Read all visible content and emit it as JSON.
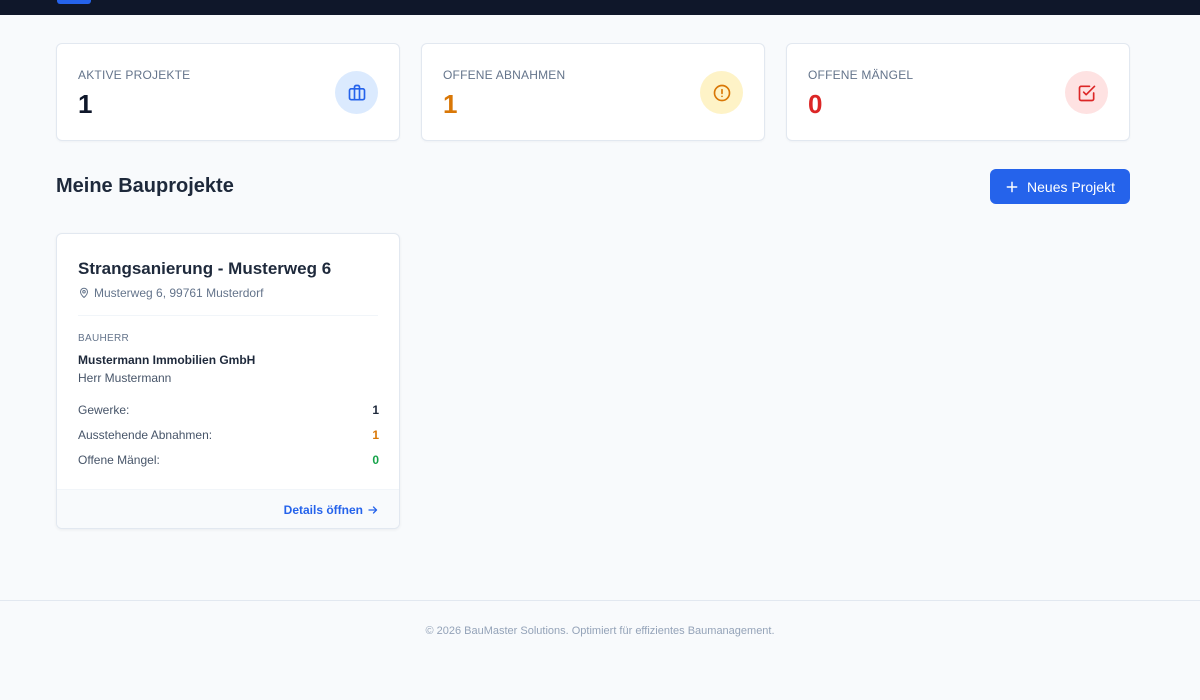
{
  "colors": {
    "primary": "#2563eb",
    "navbar": "#0f172a",
    "orange": "#d97706",
    "red": "#dc2626",
    "green": "#16a34a"
  },
  "stats": [
    {
      "label": "AKTIVE PROJEKTE",
      "value": "1",
      "icon": "briefcase-icon"
    },
    {
      "label": "OFFENE ABNAHMEN",
      "value": "1",
      "icon": "alert-circle-icon"
    },
    {
      "label": "OFFENE MÄNGEL",
      "value": "0",
      "icon": "check-square-icon"
    }
  ],
  "section": {
    "title": "Meine Bauprojekte",
    "new_project_label": "Neues Projekt"
  },
  "project": {
    "title": "Strangsanierung - Musterweg 6",
    "address": "Musterweg 6, 99761 Musterdorf",
    "client_label": "BAUHERR",
    "client_company": "Mustermann Immobilien GmbH",
    "client_contact": "Herr Mustermann",
    "metrics": [
      {
        "label": "Gewerke:",
        "value": "1"
      },
      {
        "label": "Ausstehende Abnahmen:",
        "value": "1"
      },
      {
        "label": "Offene Mängel:",
        "value": "0"
      }
    ],
    "details_label": "Details öffnen"
  },
  "footer": {
    "text": "© 2026 BauMaster Solutions. Optimiert für effizientes Baumanagement."
  }
}
